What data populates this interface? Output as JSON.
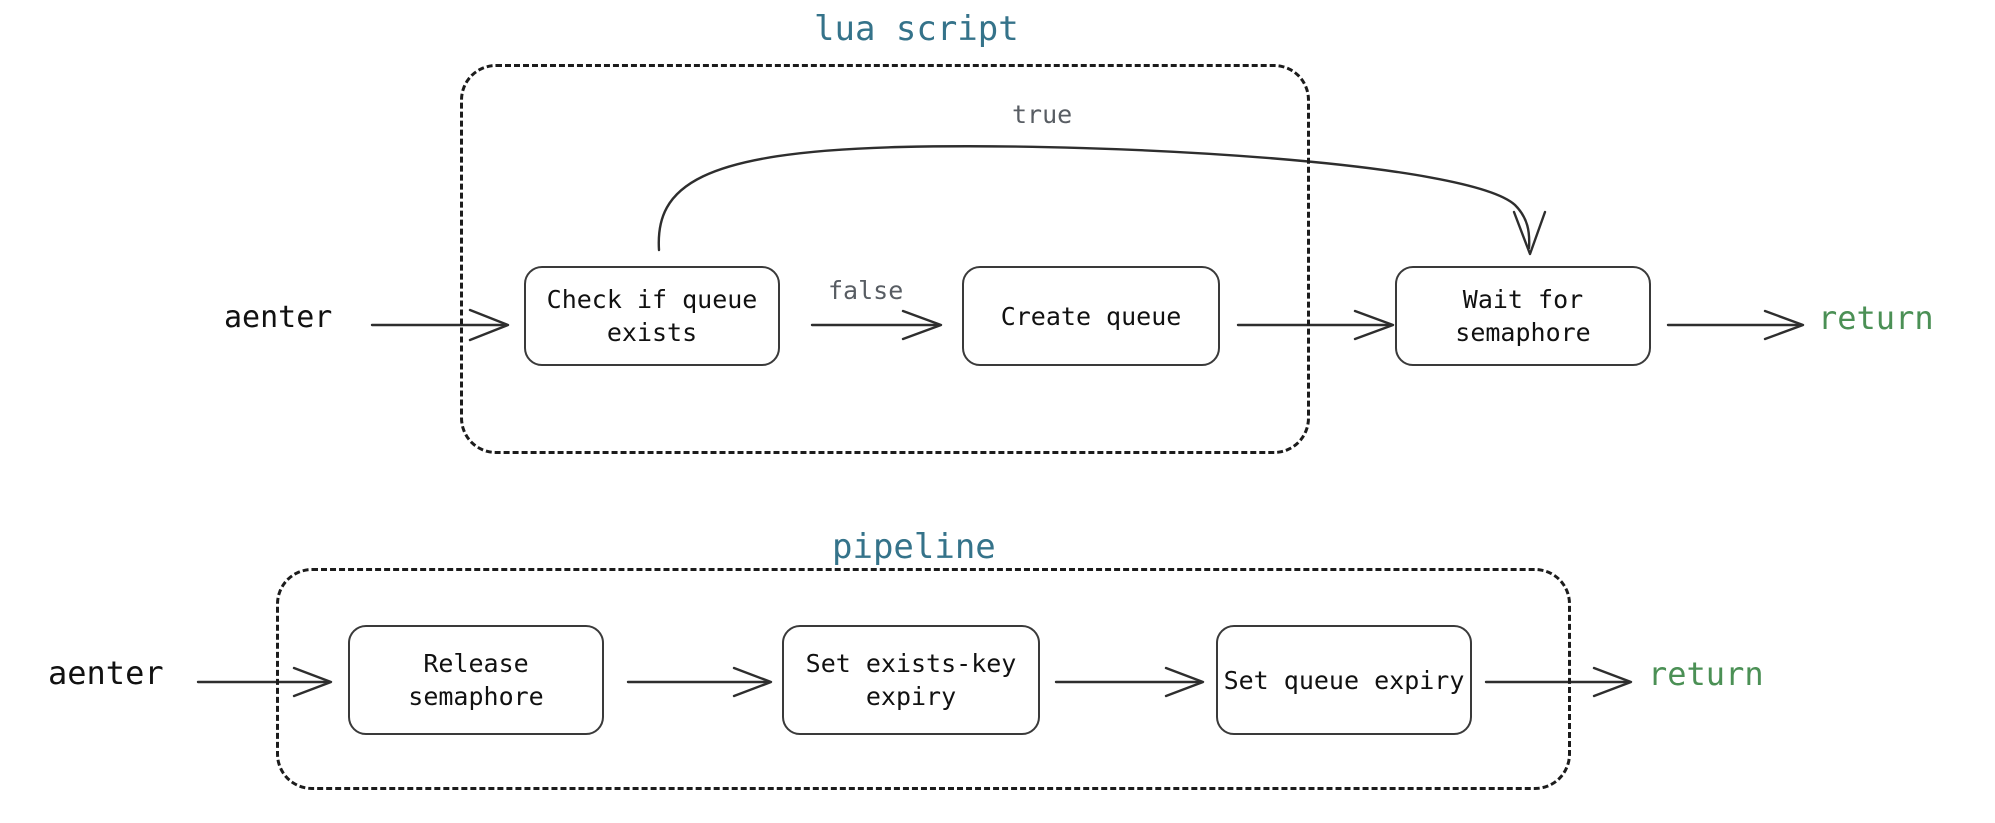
{
  "diagram": {
    "title": "aenter flow: lua script and pipeline",
    "background_color": "#ffffff",
    "colors": {
      "group_title": "#35738a",
      "node_border": "#3a3a3a",
      "node_text": "#111111",
      "edge_label": "#585d63",
      "start_label": "#111111",
      "return_label": "#4b9055",
      "arrow": "#2e2e2e",
      "group_border": "#1c1c1c"
    },
    "groups": [
      {
        "id": "lua-script",
        "label": "lua script",
        "style": "dashed-rounded",
        "nodes": [
          {
            "id": "check-if-queue-exists",
            "label": "Check if queue\nexists",
            "lines": [
              "Check if queue",
              "exists"
            ]
          },
          {
            "id": "create-queue",
            "label": "Create queue",
            "lines": [
              "Create queue"
            ]
          },
          {
            "id": "wait-for-semaphore",
            "label": "Wait for\nsemaphore",
            "lines": [
              "Wait for",
              "semaphore"
            ]
          }
        ],
        "start_label": "aenter",
        "end_label": "return",
        "edges": [
          {
            "from": "aenter",
            "to": "check-if-queue-exists",
            "label": ""
          },
          {
            "from": "check-if-queue-exists",
            "to": "create-queue",
            "label": "false"
          },
          {
            "from": "check-if-queue-exists",
            "to": "wait-for-semaphore",
            "label": "true",
            "style": "curved"
          },
          {
            "from": "create-queue",
            "to": "wait-for-semaphore",
            "label": ""
          },
          {
            "from": "wait-for-semaphore",
            "to": "return",
            "label": ""
          }
        ]
      },
      {
        "id": "pipeline",
        "label": "pipeline",
        "style": "dashed-rounded",
        "nodes": [
          {
            "id": "release-semaphore",
            "label": "Release\nsemaphore",
            "lines": [
              "Release",
              "semaphore"
            ]
          },
          {
            "id": "set-exists-key-expiry",
            "label": "Set exists-key\nexpiry",
            "lines": [
              "Set exists-key",
              "expiry"
            ]
          },
          {
            "id": "set-queue-expiry",
            "label": "Set queue expiry",
            "lines": [
              "Set queue expiry"
            ]
          }
        ],
        "start_label": "aenter",
        "end_label": "return",
        "edges": [
          {
            "from": "aenter",
            "to": "release-semaphore",
            "label": ""
          },
          {
            "from": "release-semaphore",
            "to": "set-exists-key-expiry",
            "label": ""
          },
          {
            "from": "set-exists-key-expiry",
            "to": "set-queue-expiry",
            "label": ""
          },
          {
            "from": "set-queue-expiry",
            "to": "return",
            "label": ""
          }
        ]
      }
    ],
    "labels": {
      "lua_title": "lua script",
      "pipeline_title": "pipeline",
      "top_start": "aenter",
      "top_return": "return",
      "bottom_start": "aenter",
      "bottom_return": "return",
      "true_label": "true",
      "false_label": "false",
      "node_check_line1": "Check if queue",
      "node_check_line2": "exists",
      "node_create_queue": "Create queue",
      "node_wait_line1": "Wait for",
      "node_wait_line2": "semaphore",
      "node_release_line1": "Release",
      "node_release_line2": "semaphore",
      "node_setexists_line1": "Set exists-key",
      "node_setexists_line2": "expiry",
      "node_setqueue": "Set queue expiry"
    }
  }
}
